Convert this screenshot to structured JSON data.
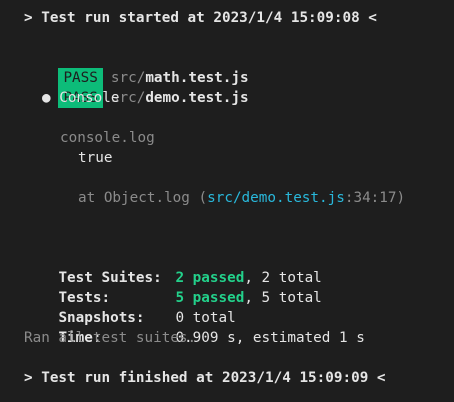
{
  "terminal": {
    "start_line": "> Test run started at 2023/1/4 15:09:08 <",
    "results": [
      {
        "badge": "PASS",
        "dir": "src/",
        "file": "math.test.js"
      },
      {
        "badge": "PASS",
        "dir": "src/",
        "file": "demo.test.js"
      }
    ],
    "console": {
      "header": "● Console",
      "log_type": "console.log",
      "value": "true",
      "trace_prefix": "at Object.log (",
      "trace_path": "src/demo.test.js",
      "trace_suffix": ":34:17)"
    },
    "summary": {
      "suites_label": "Test Suites:",
      "suites_passed": "2 passed",
      "suites_rest": ", 2 total",
      "tests_label": "Tests:",
      "tests_passed": "5 passed",
      "tests_rest": ", 5 total",
      "snapshots_label": "Snapshots:",
      "snapshots_value": "0 total",
      "time_label": "Time:",
      "time_value": "0.909 s, estimated 1 s",
      "ran_all": "Ran all test suites."
    },
    "end_line": "> Test run finished at 2023/1/4 15:09:09 <",
    "colors": {
      "background": "#1e1e1e",
      "pass_badge": "#0dbc79",
      "passed_text": "#23d18b",
      "link": "#29b8db",
      "dim": "#8b8b8b"
    }
  }
}
